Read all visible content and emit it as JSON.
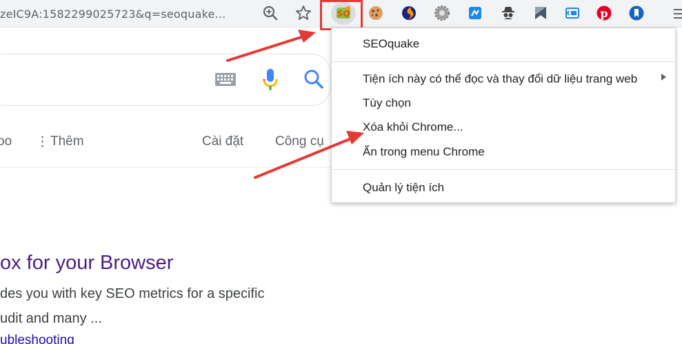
{
  "browser": {
    "url_text": "zeIC9A:1582299025723&q=seoquake..."
  },
  "search": {
    "tabs": [
      {
        "label": "oo"
      },
      {
        "label": "Thêm"
      },
      {
        "label": "Cài đặt"
      },
      {
        "label": "Công cụ"
      }
    ]
  },
  "result": {
    "title": "ox for your Browser",
    "snippet_line1": "des you with key SEO metrics for a specific",
    "snippet_line2": "udit and many ...",
    "link": "ubleshooting"
  },
  "context_menu": {
    "items": [
      {
        "label": "SEOquake"
      },
      {
        "label": "Tiện ích này có thể đọc và thay đổi dữ liệu trang web"
      },
      {
        "label": "Tùy chọn"
      },
      {
        "label": "Xóa khỏi Chrome..."
      },
      {
        "label": "Ẩn trong menu Chrome"
      },
      {
        "label": "Quản lý tiện ích"
      }
    ]
  },
  "extensions": [
    {
      "icon": "seoquake-icon"
    },
    {
      "icon": "cookie-icon"
    },
    {
      "icon": "blue-orange-circle-icon"
    },
    {
      "icon": "gear-icon"
    },
    {
      "icon": "blue-square-icon"
    },
    {
      "icon": "spy-icon"
    },
    {
      "icon": "flag-icon"
    },
    {
      "icon": "blue-bracket-icon"
    },
    {
      "icon": "pinterest-icon"
    },
    {
      "icon": "blue-bookmark-icon"
    }
  ],
  "colors": {
    "annotation": "#e53935",
    "link_visited": "#4b1e86",
    "link": "#1a0dab"
  }
}
